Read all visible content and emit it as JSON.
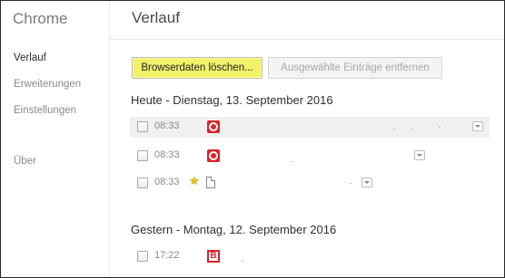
{
  "sidebar": {
    "title": "Chrome",
    "items": [
      {
        "label": "Verlauf"
      },
      {
        "label": "Erweiterungen"
      },
      {
        "label": "Einstellungen"
      },
      {
        "label": "Über"
      }
    ]
  },
  "main": {
    "title": "Verlauf",
    "buttons": {
      "clear": "Browserdaten löschen...",
      "remove": "Ausgewählte Einträge entfernen"
    },
    "days": [
      {
        "header": "Heute - Dienstag, 13. September 2016",
        "entries": [
          {
            "time": "08:33",
            "icon": "red-ring-icon",
            "highlighted": true
          },
          {
            "time": "08:33",
            "icon": "red-ring-icon",
            "highlighted": false
          },
          {
            "time": "08:33",
            "icon": "page-icon",
            "starred": true,
            "highlighted": false
          }
        ]
      },
      {
        "header": "Gestern - Montag, 12. September 2016",
        "entries": [
          {
            "time": "17:22",
            "icon": "red-b-icon",
            "icon_letter": "B",
            "highlighted": false
          }
        ]
      }
    ]
  },
  "colors": {
    "accent_button": "#f2f26a",
    "favicon_red": "#d9252b",
    "star": "#e8c800"
  }
}
